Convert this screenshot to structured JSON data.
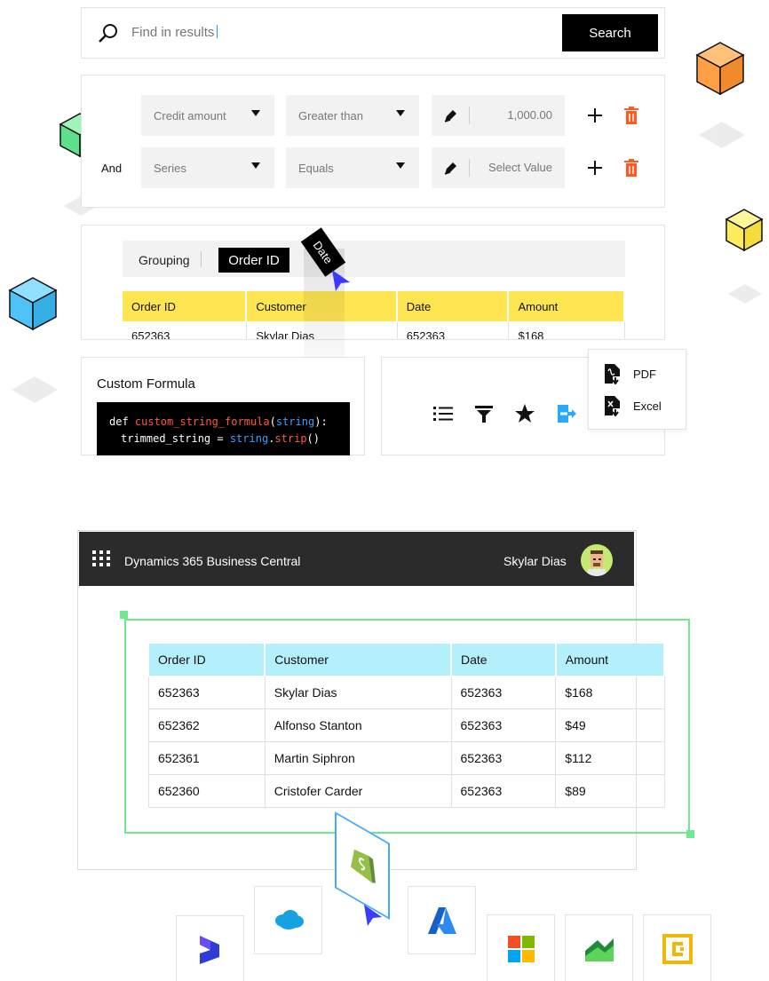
{
  "search": {
    "placeholder": "Find in results",
    "button": "Search"
  },
  "filters": {
    "connector": "And",
    "rows": [
      {
        "field": "Credit amount",
        "operator": "Greater than",
        "value": "1,000.00"
      },
      {
        "field": "Series",
        "operator": "Equals",
        "value": "Select Value"
      }
    ]
  },
  "grouping": {
    "label": "Grouping",
    "chip": "Order ID",
    "dragged_chip": "Date",
    "columns": [
      "Order ID",
      "Customer",
      "Date",
      "Amount"
    ],
    "rows": [
      [
        "652363",
        "Skylar Dias",
        "652363",
        "$168"
      ]
    ]
  },
  "formula": {
    "title": "Custom Formula",
    "line1": {
      "kw": "def ",
      "fn": "custom_string_formula",
      "p1": "(",
      "arg": "string",
      "p2": "):"
    },
    "line2": {
      "lhs": "trimmed_string = ",
      "obj": "string",
      "dot": ".",
      "method": "strip",
      "tail": "()"
    }
  },
  "toolbar": {
    "icons": [
      "list-icon",
      "filter-icon",
      "star-icon",
      "export-icon"
    ],
    "export_menu": [
      "PDF",
      "Excel"
    ]
  },
  "app": {
    "title": "Dynamics 365 Business Central",
    "user": "Skylar Dias",
    "table": {
      "columns": [
        "Order ID",
        "Customer",
        "Date",
        "Amount"
      ],
      "rows": [
        [
          "652363",
          "Skylar Dias",
          "652363",
          "$168"
        ],
        [
          "652362",
          "Alfonso Stanton",
          "652363",
          "$49"
        ],
        [
          "652361",
          "Martin Siphron",
          "652363",
          "$112"
        ],
        [
          "652360",
          "Cristofer Carder",
          "652363",
          "$89"
        ]
      ]
    }
  },
  "integrations": [
    "dynamics-logo",
    "salesforce-logo",
    "shopify-logo",
    "azure-logo",
    "microsoft-logo",
    "green-chart-logo",
    "yellow-c-logo"
  ],
  "colors": {
    "accent_yellow": "#ffe552",
    "accent_cyan": "#b4f0fb",
    "selection_green": "#6eea8e",
    "delete_orange": "#ff5a1f",
    "cursor_blue": "#3b3bff"
  }
}
